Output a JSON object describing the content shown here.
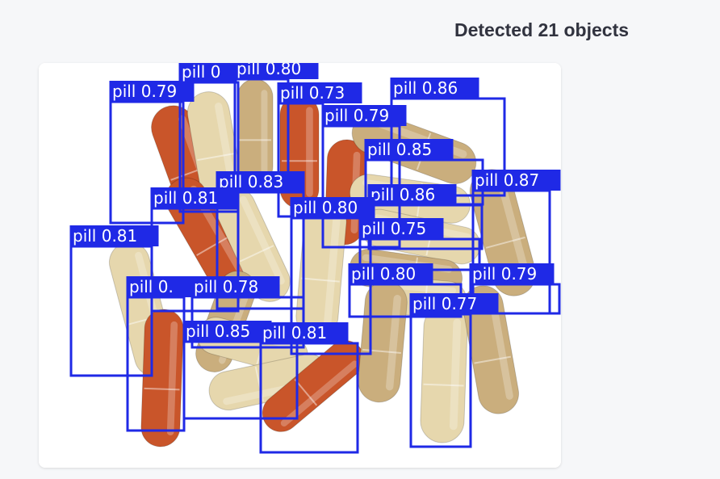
{
  "header": {
    "title": "Detected 21 objects"
  },
  "detection": {
    "image_alt": "pills",
    "box_color": "#1f29e6",
    "label_text_color": "#ffffff",
    "pill_colors": {
      "orange": "#c9552a",
      "cream": "#e6d7ad",
      "tan": "#caae7d"
    },
    "labels": [
      "pill 0.79",
      "pill 0",
      "pill 0.80",
      "pill 0.73",
      "pill 0.86",
      "pill 0.79",
      "pill 0.85",
      "pill 0.83",
      "pill 0.87",
      "pill 0.81",
      "pill 0.86",
      "pill 0.80",
      "pill 0.81",
      "pill 0.75",
      "pill 0.80",
      "pill 0.79",
      "pill 0.",
      "pill 0.78",
      "pill 0.77",
      "pill 0.85",
      "pill 0.81"
    ]
  }
}
